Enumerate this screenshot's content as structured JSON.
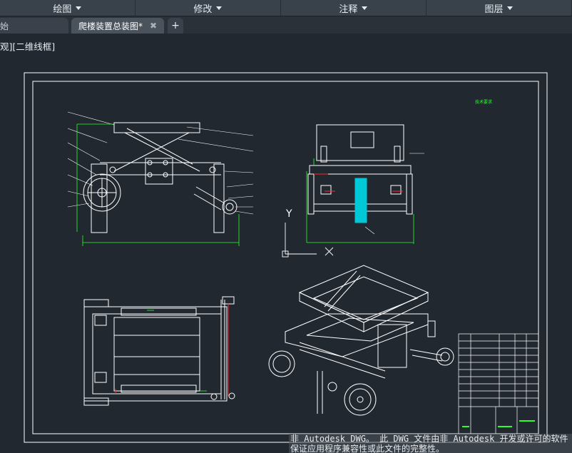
{
  "ribbon": {
    "menus": [
      {
        "label": "绘图"
      },
      {
        "label": "修改"
      },
      {
        "label": "注释"
      },
      {
        "label": "图层"
      }
    ]
  },
  "tabs": {
    "start_label": "始",
    "active_label": "爬楼装置总装图*",
    "close_glyph": "✖",
    "add_glyph": "+"
  },
  "viewport": {
    "view_label": "观][二维线框]"
  },
  "ucs": {
    "x_label": "X",
    "y_label": "Y"
  },
  "drawing": {
    "specs_title": "技术要求",
    "colors": {
      "background": "#212830",
      "lines": "#ffffff",
      "dimensions": "#2aff2a",
      "accent_cyan": "#00c8d8",
      "accent_red": "#ff2a2a"
    }
  },
  "watermark": {
    "line1": "非 Autodesk DWG。 此 DWG 文件由非 Autodesk 开发或许可的软件",
    "line2": "保证应用程序兼容性或此文件的完整性。"
  }
}
